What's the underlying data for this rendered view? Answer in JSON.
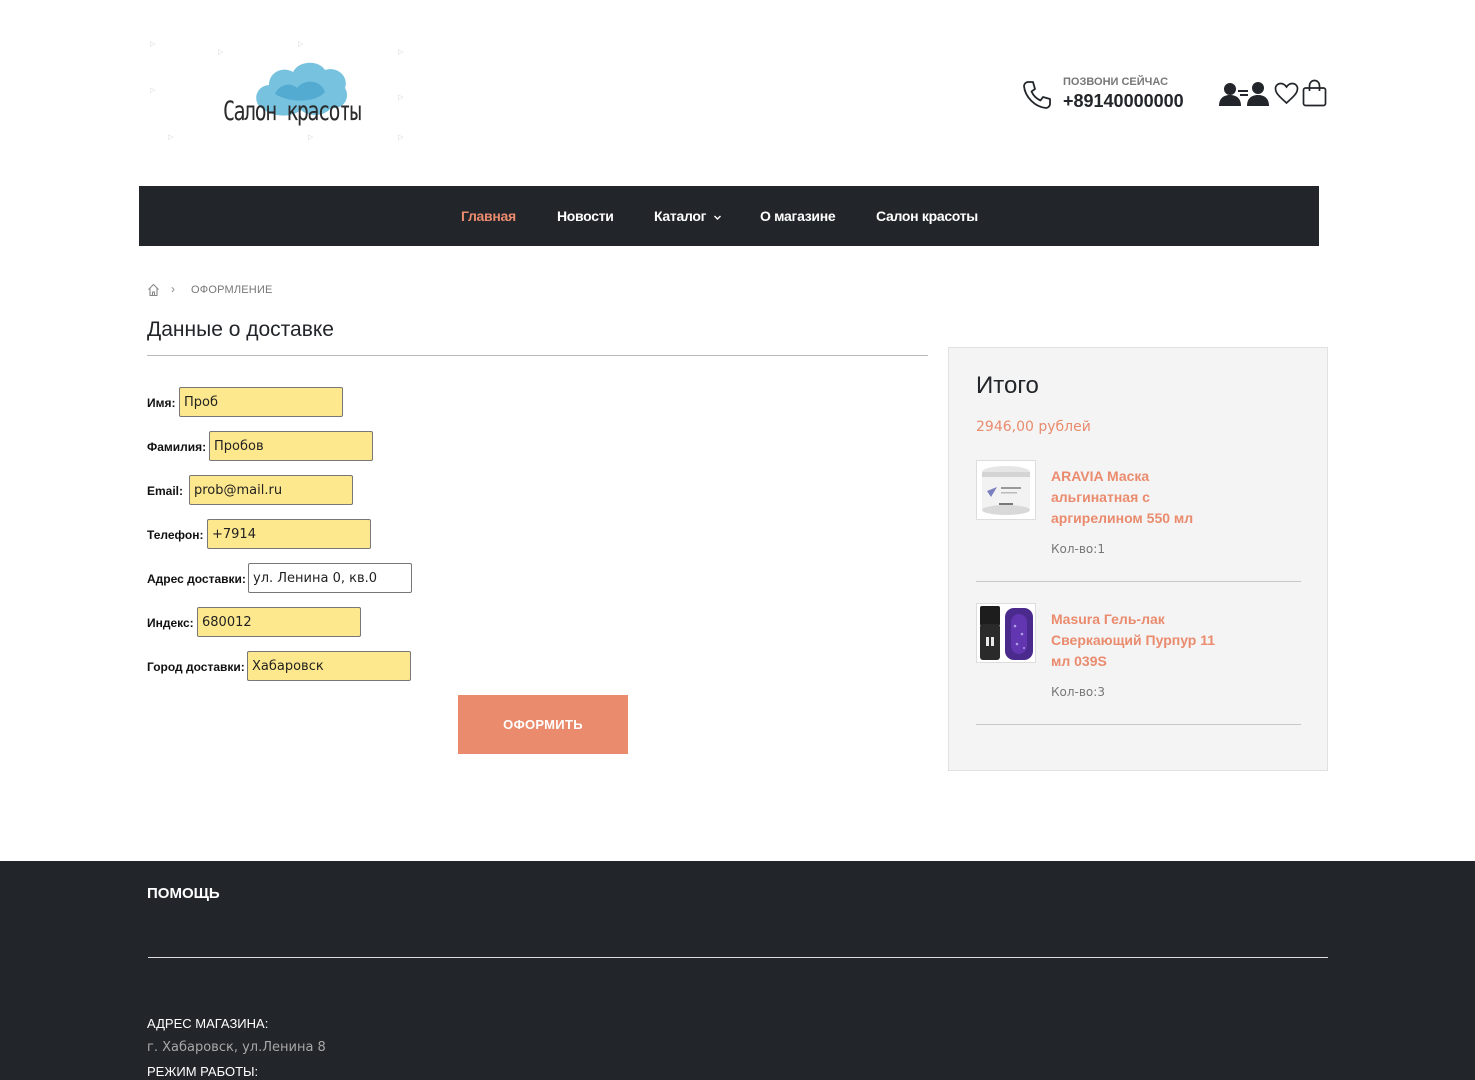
{
  "header": {
    "logo_text": "Салон красоты",
    "call_label": "ПОЗВОНИ СЕЙЧАС",
    "phone": "+89140000000",
    "icons": [
      "phone-icon",
      "account-icon",
      "users-icon",
      "heart-icon",
      "cart-icon"
    ]
  },
  "nav": {
    "items": [
      {
        "label": "Главная",
        "active": true
      },
      {
        "label": "Новости"
      },
      {
        "label": "Каталог",
        "has_dropdown": true
      },
      {
        "label": "О магазине"
      },
      {
        "label": "Салон красоты"
      }
    ]
  },
  "breadcrumb": {
    "current": "ОФОРМЛЕНИЕ"
  },
  "form": {
    "title": "Данные о доставке",
    "fields": [
      {
        "label": "Имя:",
        "value": "Проб"
      },
      {
        "label": "Фамилия:",
        "value": "Пробов"
      },
      {
        "label": "Email:",
        "value": "prob@mail.ru"
      },
      {
        "label": "Телефон:",
        "value": "+7914"
      },
      {
        "label": "Адрес доставки:",
        "value": "ул. Ленина 0, кв.0"
      },
      {
        "label": "Индекс:",
        "value": "680012"
      },
      {
        "label": "Город доставки:",
        "value": "Хабаровск"
      }
    ],
    "submit_label": "ОФОРМИТЬ"
  },
  "summary": {
    "title": "Итого",
    "total": "2946,00 рублей",
    "products": [
      {
        "name": "ARAVIA Маска альгинатная с аргирелином 550 мл",
        "qty": "Кол-во:1"
      },
      {
        "name": "Masura Гель-лак Сверкающий Пурпур 11 мл 039S",
        "qty": "Кол-во:3"
      }
    ]
  },
  "footer": {
    "title": "ПОМОЩЬ",
    "address_label": "АДРЕС МАГАЗИНА:",
    "address_value": "г. Хабаровск, ул.Ленина 8",
    "hours_label": "РЕЖИМ РАБОТЫ:"
  },
  "colors": {
    "accent": "#ea8b6e",
    "dark": "#222529",
    "autofill": "#fee88d"
  }
}
